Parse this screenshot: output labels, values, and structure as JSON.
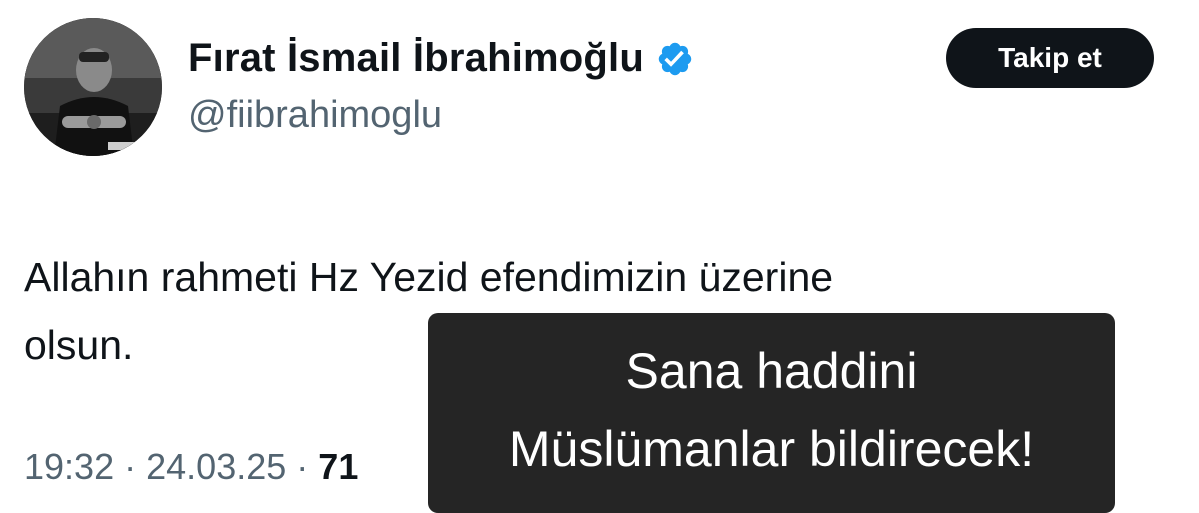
{
  "profile": {
    "display_name": "Fırat İsmail İbrahimoğlu",
    "handle": "@fiibrahimoglu",
    "avatar_icon": "profile-photo",
    "verified_icon": "verified-badge-icon",
    "verified_color": "#1d9bf0"
  },
  "follow_button": {
    "label": "Takip et"
  },
  "tweet": {
    "text_line1": "Allahın rahmeti Hz Yezid efendimizin üzerine",
    "text_line2": "olsun.",
    "time": "19:32",
    "separator": "·",
    "date": "24.03.25",
    "views_visible": "71"
  },
  "caption_overlay": {
    "line1": "Sana haddini",
    "line2": "Müslümanlar bildirecek!",
    "background": "#252525"
  }
}
